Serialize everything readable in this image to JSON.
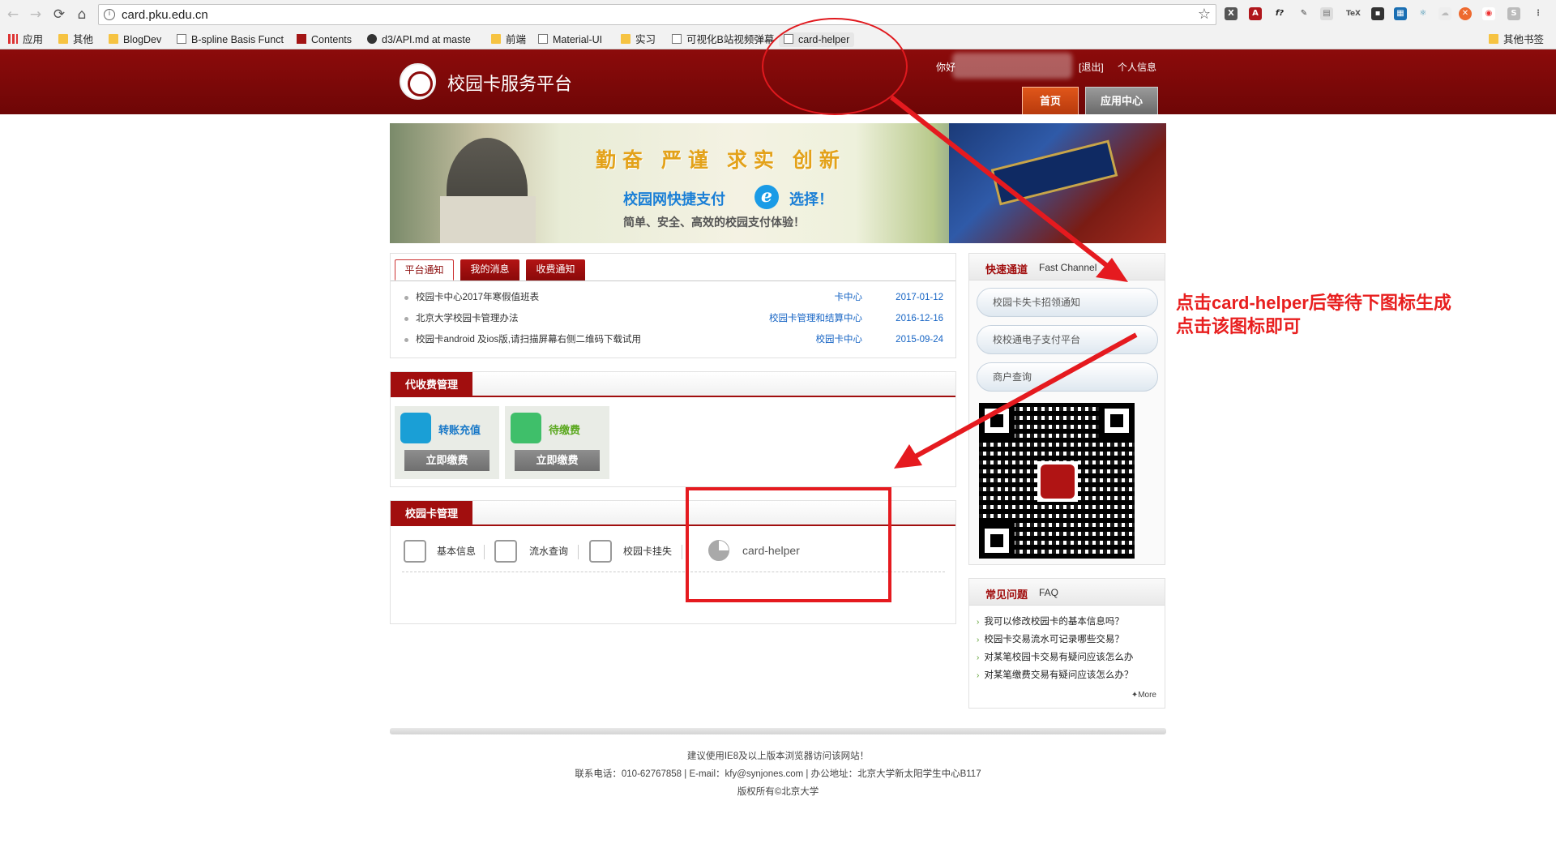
{
  "browser": {
    "url": "card.pku.edu.cn",
    "bookmarks": [
      {
        "label": "应用",
        "icon": "apps-icon"
      },
      {
        "label": "其他",
        "icon": "folder-icon"
      },
      {
        "label": "BlogDev",
        "icon": "folder-icon"
      },
      {
        "label": "B-spline Basis Funct",
        "icon": "page-icon"
      },
      {
        "label": "Contents",
        "icon": "bar-icon"
      },
      {
        "label": "d3/API.md at maste",
        "icon": "github-icon"
      },
      {
        "label": "前端",
        "icon": "folder-icon"
      },
      {
        "label": "Material-UI",
        "icon": "mui-icon"
      },
      {
        "label": "实习",
        "icon": "folder-icon"
      },
      {
        "label": "可视化B站视频弹幕",
        "icon": "page-icon"
      },
      {
        "label": "card-helper",
        "icon": "page-icon"
      }
    ],
    "other_bookmarks": "其他书签"
  },
  "header": {
    "site_title": "校园卡服务平台",
    "greeting": "你好",
    "logout": "[退出]",
    "profile": "个人信息",
    "tabs": [
      "首页",
      "应用中心"
    ]
  },
  "banner": {
    "slogan": "勤奋  严谨  求实  创新",
    "line1a": "校园网快捷支付",
    "line1b": "选择！",
    "line2": "简单、安全、高效的校园支付体验！"
  },
  "notices": {
    "tabs": [
      "平台通知",
      "我的消息",
      "收费通知"
    ],
    "items": [
      {
        "title": "校园卡中心2017年寒假值班表",
        "source": "卡中心",
        "date": "2017-01-12"
      },
      {
        "title": "北京大学校园卡管理办法",
        "source": "校园卡管理和结算中心",
        "date": "2016-12-16"
      },
      {
        "title": "校园卡android 及ios版,请扫描屏幕右侧二维码下载试用",
        "source": "校园卡中心",
        "date": "2015-09-24"
      }
    ]
  },
  "fees": {
    "title": "代收费管理",
    "cards": [
      {
        "label": "转账充值",
        "button": "立即缴费",
        "label_color": "#1878c8",
        "icon_color": "#1a9fd6"
      },
      {
        "label": "待缴费",
        "button": "立即缴费",
        "label_color": "#5aa81e",
        "icon_color": "#3fbf6a"
      }
    ]
  },
  "card_mgmt": {
    "title": "校园卡管理",
    "items": [
      "基本信息",
      "流水查询",
      "校园卡挂失"
    ],
    "extension_item": "card-helper"
  },
  "quick": {
    "title_cn": "快速通道",
    "title_en": "Fast Channel",
    "buttons": [
      "校园卡失卡招领通知",
      "校校通电子支付平台",
      "商户查询"
    ]
  },
  "faq": {
    "title_cn": "常见问题",
    "title_en": "FAQ",
    "items": [
      "我可以修改校园卡的基本信息吗？",
      "校园卡交易流水可记录哪些交易？",
      "对某笔校园卡交易有疑问应该怎么办",
      "对某笔缴费交易有疑问应该怎么办？"
    ],
    "more": "More"
  },
  "footer": {
    "line1": "建议使用IE8及以上版本浏览器访问该网站！",
    "line2": "联系电话：010-62767858 | E-mail：kfy@synjones.com | 办公地址：北京大学新太阳学生中心B117",
    "line3": "版权所有©北京大学"
  },
  "annotation": {
    "text_line1": "点击card-helper后等待下图标生成",
    "text_line2": "点击该图标即可",
    "color": "#e81f1f"
  },
  "colors": {
    "brand": "#8c0b0b",
    "link": "#1664c4"
  }
}
